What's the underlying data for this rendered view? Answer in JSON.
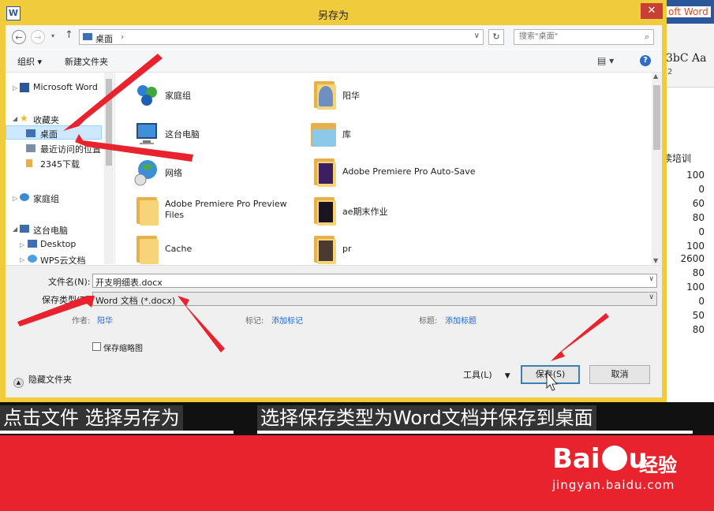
{
  "dialog": {
    "title": "另存为",
    "close_label": "✕",
    "app_icon_label": "W"
  },
  "nav": {
    "address": "桌面",
    "search_placeholder": "搜索\"桌面\""
  },
  "toolbar": {
    "organize_label": "组织 ▾",
    "new_folder_label": "新建文件夹"
  },
  "tree": {
    "items": [
      {
        "label": "Microsoft Word"
      },
      {
        "label": "收藏夹"
      },
      {
        "label": "桌面"
      },
      {
        "label": "最近访问的位置"
      },
      {
        "label": "2345下载"
      },
      {
        "label": "家庭组"
      },
      {
        "label": "这台电脑"
      },
      {
        "label": "Desktop"
      },
      {
        "label": "WPS云文档"
      }
    ]
  },
  "files": {
    "items": [
      {
        "label": "家庭组"
      },
      {
        "label": "阳华"
      },
      {
        "label": "这台电脑"
      },
      {
        "label": "库"
      },
      {
        "label": "网络"
      },
      {
        "label": "Adobe Premiere Pro Auto-Save"
      },
      {
        "label": "Adobe Premiere Pro Preview Files"
      },
      {
        "label": "ae期末作业"
      },
      {
        "label": "Cache"
      },
      {
        "label": "pr"
      }
    ]
  },
  "form": {
    "filename_label": "文件名(N):",
    "filename_value": "开支明细表.docx",
    "filetype_label": "保存类型(T):",
    "filetype_value": "Word 文档 (*.docx)",
    "author_label": "作者:",
    "author_value": "阳华",
    "tags_label": "标记:",
    "tags_value": "添加标记",
    "title_label": "标题:",
    "title_value": "添加标题",
    "thumbnail_label": "保存缩略图",
    "hide_folders_label": "隐藏文件夹",
    "tools_label": "工具(L)",
    "save_label": "保存(S)",
    "cancel_label": "取消"
  },
  "word_bg": {
    "title_text": "oft Word",
    "styles_text": "3bC Aa",
    "ribbon_num": "2",
    "page_text": "读培训",
    "numbers": [
      "100",
      "0",
      "60",
      "80",
      "0",
      "100",
      "2600",
      "80",
      "100",
      "0",
      "50",
      "80"
    ]
  },
  "captions": {
    "left": "点击文件 选择另存为",
    "right": "选择保存类型为Word文档并保存到桌面"
  },
  "watermark": {
    "logo_left": "Bai",
    "logo_right": "u",
    "jingyan": "经验",
    "url": "jingyan.baidu.com"
  },
  "colors": {
    "dialog_frame": "#f0cc3c",
    "close_button": "#c84035",
    "selection": "#cde8ff",
    "link": "#2a6ac8",
    "arrow": "#e8232d",
    "baidu_red": "#e8232d"
  }
}
